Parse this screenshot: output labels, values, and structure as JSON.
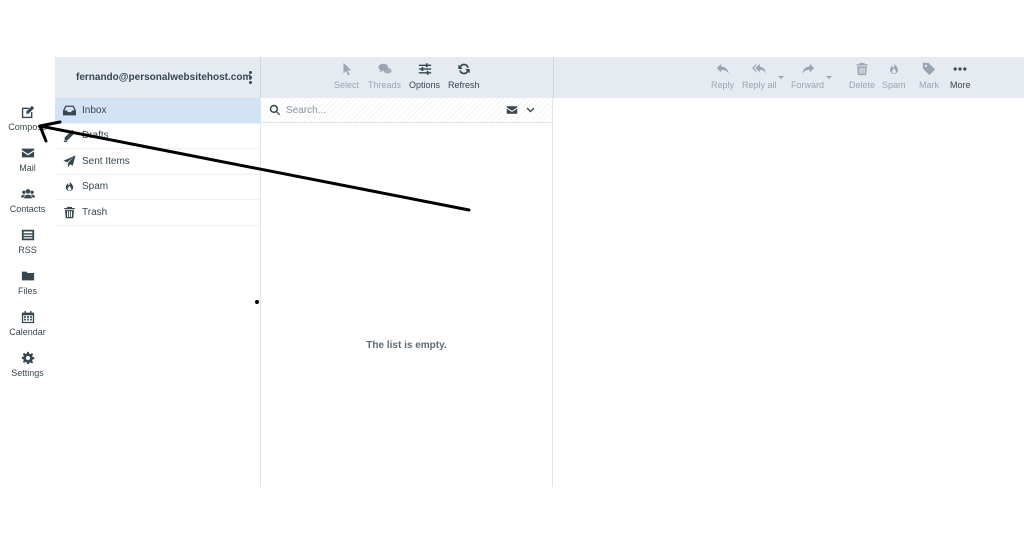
{
  "account": {
    "email": "fernando@personalwebsitehost.com"
  },
  "nav": [
    {
      "label": "Compose",
      "icon": "compose-icon"
    },
    {
      "label": "Mail",
      "icon": "envelope-icon"
    },
    {
      "label": "Contacts",
      "icon": "users-icon"
    },
    {
      "label": "RSS",
      "icon": "rss-icon"
    },
    {
      "label": "Files",
      "icon": "folder-icon"
    },
    {
      "label": "Calendar",
      "icon": "calendar-icon"
    },
    {
      "label": "Settings",
      "icon": "gear-icon"
    }
  ],
  "folders": [
    {
      "label": "Inbox",
      "icon": "inbox-icon",
      "selected": true
    },
    {
      "label": "Drafts",
      "icon": "pencil-icon"
    },
    {
      "label": "Sent Items",
      "icon": "paper-plane-icon"
    },
    {
      "label": "Spam",
      "icon": "fire-icon"
    },
    {
      "label": "Trash",
      "icon": "trash-icon"
    }
  ],
  "list_toolbar": [
    {
      "label": "Select",
      "icon": "cursor-icon",
      "enabled": false
    },
    {
      "label": "Threads",
      "icon": "threads-icon",
      "enabled": false
    },
    {
      "label": "Options",
      "icon": "sliders-icon",
      "enabled": true
    },
    {
      "label": "Refresh",
      "icon": "refresh-icon",
      "enabled": true
    }
  ],
  "message_toolbar": [
    {
      "label": "Reply",
      "icon": "reply-icon",
      "enabled": false
    },
    {
      "label": "Reply all",
      "icon": "reply-all-icon",
      "enabled": false
    },
    {
      "label": "Forward",
      "icon": "forward-icon",
      "enabled": false
    },
    {
      "label": "Delete",
      "icon": "trash-icon",
      "enabled": false
    },
    {
      "label": "Spam",
      "icon": "fire-icon",
      "enabled": false
    },
    {
      "label": "Mark",
      "icon": "tag-icon",
      "enabled": false
    },
    {
      "label": "More",
      "icon": "more-icon",
      "enabled": true
    }
  ],
  "search": {
    "placeholder": "Search..."
  },
  "message_list": {
    "empty_text": "The list is empty."
  }
}
